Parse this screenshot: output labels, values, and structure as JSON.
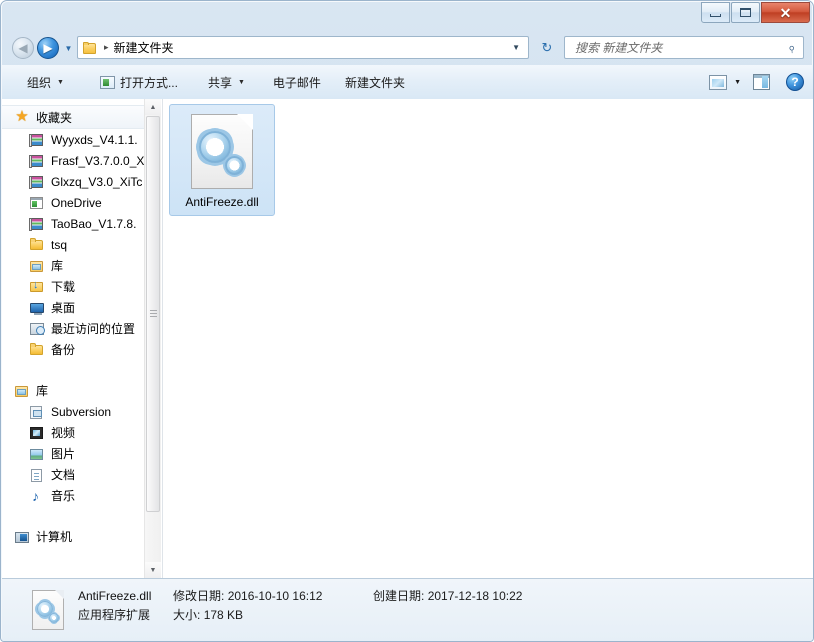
{
  "window": {
    "minimize_label": "—",
    "maximize_label": "□",
    "close_label": "✕"
  },
  "nav": {
    "back_glyph": "◀",
    "forward_glyph": "▶",
    "history_caret": "▼",
    "breadcrumb_separator": "▸",
    "breadcrumb_text": "新建文件夹",
    "address_caret": "▼",
    "refresh_glyph": "↻",
    "search_placeholder": "搜索 新建文件夹",
    "search_value": "",
    "search_glyph": "⌕"
  },
  "toolbar": {
    "items": [
      {
        "label": "组织",
        "caret": "▼",
        "icon": "none"
      },
      {
        "label": "打开方式...",
        "caret": "",
        "icon": "open-with-icon"
      },
      {
        "label": "共享",
        "caret": "▼",
        "icon": "none"
      },
      {
        "label": "电子邮件",
        "caret": "",
        "icon": "none"
      },
      {
        "label": "新建文件夹",
        "caret": "",
        "icon": "none"
      }
    ],
    "view_caret": "▼",
    "help_label": "?"
  },
  "sidebar": {
    "groups": [
      {
        "header": {
          "label": "收藏夹",
          "icon": "star-icon",
          "active": true
        },
        "items": [
          {
            "label": "Wyyxds_V4.1.1.",
            "icon": "archive-icon"
          },
          {
            "label": "Frasf_V3.7.0.0_X",
            "icon": "archive-icon"
          },
          {
            "label": "Glxzq_V3.0_XiTc",
            "icon": "archive-icon"
          },
          {
            "label": "OneDrive",
            "icon": "onedrive-icon"
          },
          {
            "label": "TaoBao_V1.7.8.",
            "icon": "archive-icon"
          },
          {
            "label": "tsq",
            "icon": "folder-icon"
          },
          {
            "label": "库",
            "icon": "library-icon"
          },
          {
            "label": "下载",
            "icon": "download-icon"
          },
          {
            "label": "桌面",
            "icon": "desktop-icon"
          },
          {
            "label": "最近访问的位置",
            "icon": "recent-places-icon"
          },
          {
            "label": "备份",
            "icon": "folder-icon"
          }
        ]
      },
      {
        "header": {
          "label": "库",
          "icon": "library-icon",
          "active": false
        },
        "items": [
          {
            "label": "Subversion",
            "icon": "subversion-icon"
          },
          {
            "label": "视频",
            "icon": "video-icon"
          },
          {
            "label": "图片",
            "icon": "pictures-icon"
          },
          {
            "label": "文档",
            "icon": "documents-icon"
          },
          {
            "label": "音乐",
            "icon": "music-icon"
          }
        ]
      },
      {
        "header": {
          "label": "计算机",
          "icon": "computer-icon",
          "active": false
        },
        "items": []
      }
    ],
    "scrollbar": {
      "up_glyph": "▲",
      "down_glyph": "▼"
    }
  },
  "files": [
    {
      "name": "AntiFreeze.dll",
      "icon": "dll-gears-icon",
      "selected": true
    }
  ],
  "details": {
    "file_name": "AntiFreeze.dll",
    "file_type": "应用程序扩展",
    "modified_label": "修改日期:",
    "modified_value": "2016-10-10 16:12",
    "created_label": "创建日期:",
    "created_value": "2017-12-18 10:22",
    "size_label": "大小:",
    "size_value": "178 KB"
  },
  "colors": {
    "accent": "#2b6fae",
    "selection": "#cde3f6",
    "selection_border": "#a7c9e8",
    "frame": "#cbddee",
    "close_red": "#bf3f23"
  }
}
